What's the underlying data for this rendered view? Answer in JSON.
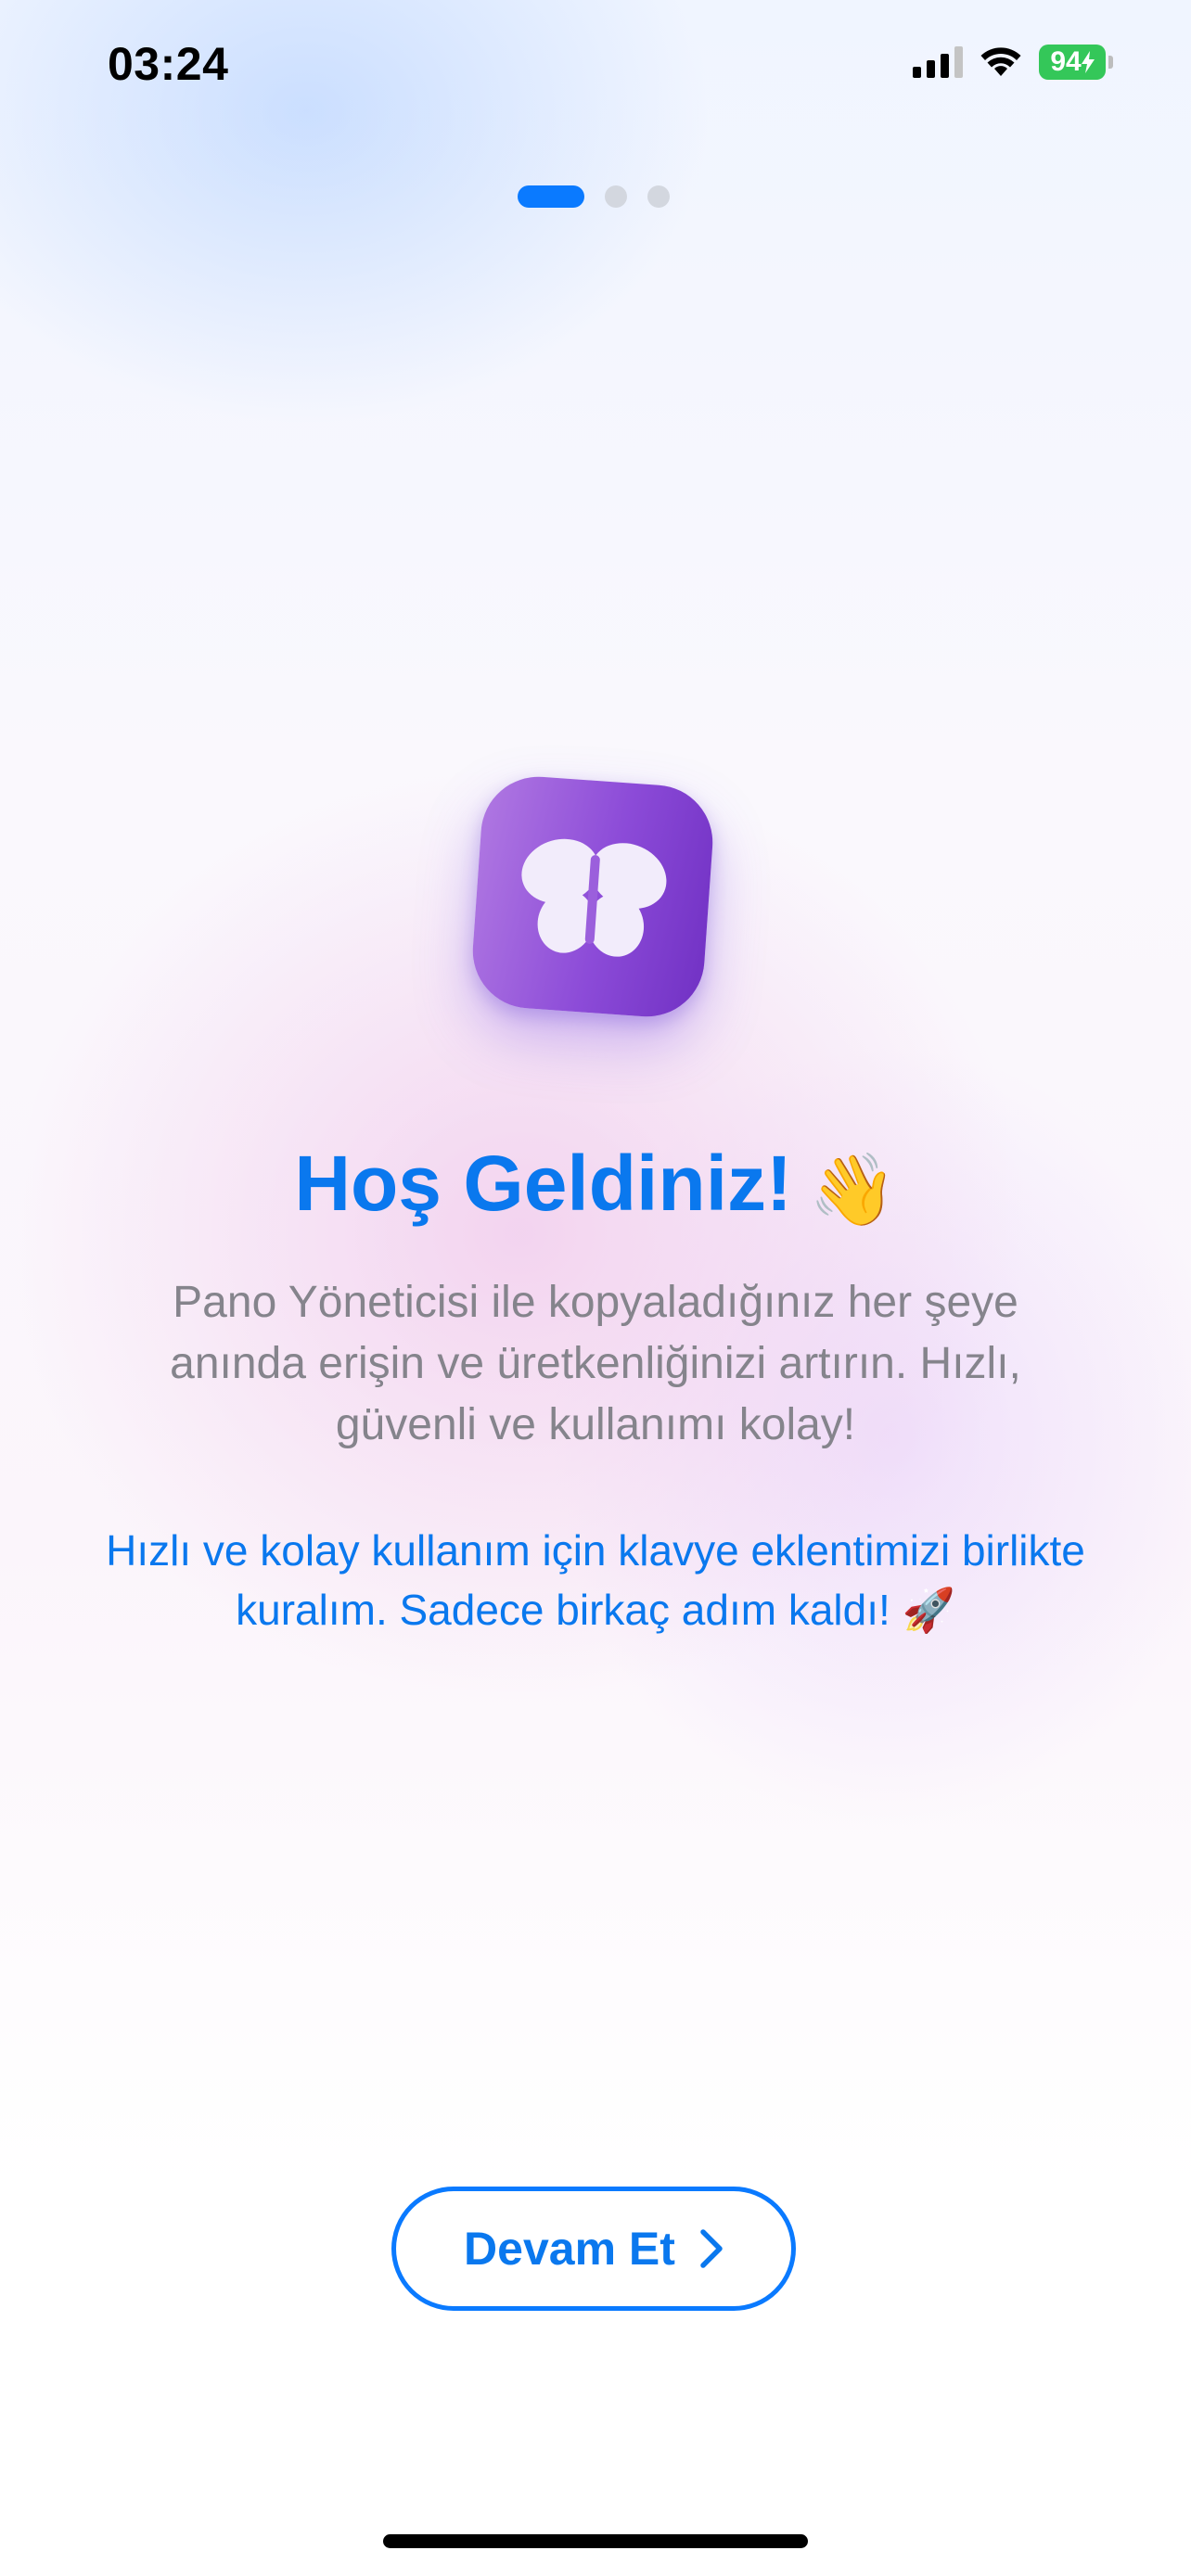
{
  "status_bar": {
    "time": "03:24",
    "battery_level": "94",
    "battery_charging": true,
    "icons": [
      "signal-icon",
      "wifi-icon",
      "battery-icon"
    ]
  },
  "pager": {
    "pages": 3,
    "current": 1
  },
  "app_icon": {
    "icon": "butterfly-icon"
  },
  "welcome": {
    "title": "Hoş Geldiniz!",
    "title_emoji": "👋",
    "description": "Pano Yöneticisi ile kopyaladığınız her şeye anında erişin ve üretkenliğinizi artırın. Hızlı, güvenli ve kullanımı kolay!",
    "note": "Hızlı ve kolay kullanım için klavye eklentimizi birlikte kuralım. Sadece birkaç adım kaldı! 🚀"
  },
  "actions": {
    "continue_label": "Devam Et",
    "continue_icon": "chevron-right-icon"
  },
  "colors": {
    "accent": "#0A7AFF",
    "text_secondary": "#85848C",
    "battery_green": "#34C759",
    "icon_purple": "#8C4BD8"
  }
}
